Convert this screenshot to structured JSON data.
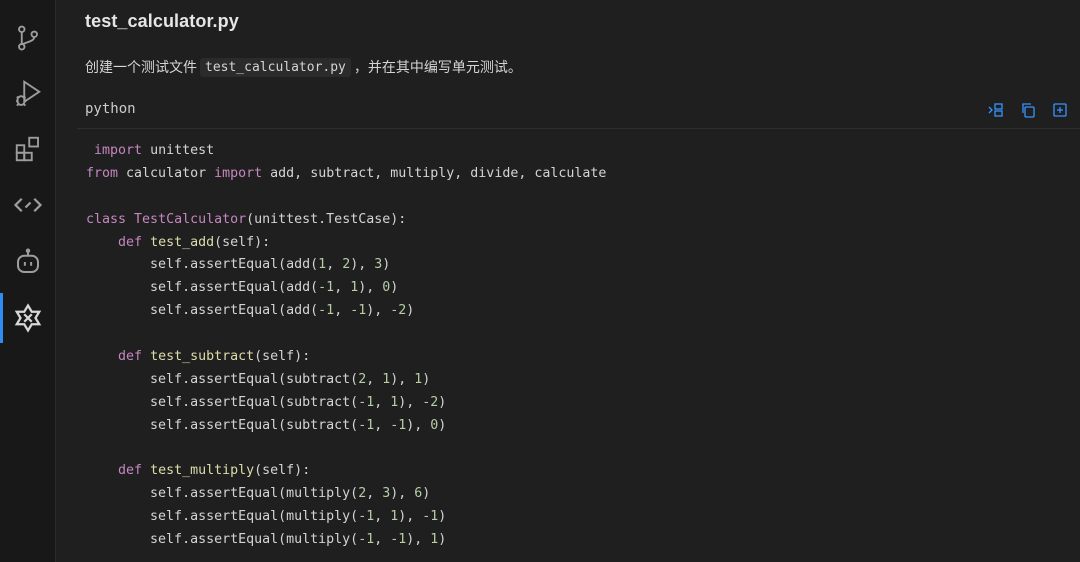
{
  "activity_bar": {
    "items": [
      {
        "name": "source-control-icon"
      },
      {
        "name": "run-debug-icon"
      },
      {
        "name": "extensions-icon"
      },
      {
        "name": "remote-explorer-icon"
      },
      {
        "name": "copilot-bot-icon"
      },
      {
        "name": "ai-assistant-icon",
        "active": true
      }
    ],
    "accent_color": "#2f8cf0"
  },
  "header": {
    "file_title": "test_calculator.py"
  },
  "description": {
    "prefix": "创建一个测试文件",
    "inline_code": "test_calculator.py",
    "suffix": "，并在其中编写单元测试。"
  },
  "code_block": {
    "language": "python",
    "actions": [
      "insert-at-cursor-icon",
      "copy-icon",
      "new-file-icon"
    ],
    "lines": [
      [
        {
          "t": " ",
          "k": "plain"
        },
        {
          "t": "import",
          "k": "kw"
        },
        {
          "t": " unittest",
          "k": "plain"
        }
      ],
      [
        {
          "t": "from",
          "k": "kw"
        },
        {
          "t": " calculator ",
          "k": "plain"
        },
        {
          "t": "import",
          "k": "kw"
        },
        {
          "t": " add, subtract, multiply, divide, calculate",
          "k": "plain"
        }
      ],
      [],
      [
        {
          "t": "class",
          "k": "kw"
        },
        {
          "t": " ",
          "k": "plain"
        },
        {
          "t": "TestCalculator",
          "k": "cls"
        },
        {
          "t": "(unittest.TestCase):",
          "k": "plain"
        }
      ],
      [
        {
          "t": "    ",
          "k": "plain"
        },
        {
          "t": "def",
          "k": "kw"
        },
        {
          "t": " ",
          "k": "plain"
        },
        {
          "t": "test_add",
          "k": "fn"
        },
        {
          "t": "(self):",
          "k": "plain"
        }
      ],
      [
        {
          "t": "        self.assertEqual(add(",
          "k": "plain"
        },
        {
          "t": "1",
          "k": "num"
        },
        {
          "t": ", ",
          "k": "plain"
        },
        {
          "t": "2",
          "k": "num"
        },
        {
          "t": "), ",
          "k": "plain"
        },
        {
          "t": "3",
          "k": "num"
        },
        {
          "t": ")",
          "k": "plain"
        }
      ],
      [
        {
          "t": "        self.assertEqual(add(",
          "k": "plain"
        },
        {
          "t": "-1",
          "k": "num"
        },
        {
          "t": ", ",
          "k": "plain"
        },
        {
          "t": "1",
          "k": "num"
        },
        {
          "t": "), ",
          "k": "plain"
        },
        {
          "t": "0",
          "k": "num"
        },
        {
          "t": ")",
          "k": "plain"
        }
      ],
      [
        {
          "t": "        self.assertEqual(add(",
          "k": "plain"
        },
        {
          "t": "-1",
          "k": "num"
        },
        {
          "t": ", ",
          "k": "plain"
        },
        {
          "t": "-1",
          "k": "num"
        },
        {
          "t": "), ",
          "k": "plain"
        },
        {
          "t": "-2",
          "k": "num"
        },
        {
          "t": ")",
          "k": "plain"
        }
      ],
      [],
      [
        {
          "t": "    ",
          "k": "plain"
        },
        {
          "t": "def",
          "k": "kw"
        },
        {
          "t": " ",
          "k": "plain"
        },
        {
          "t": "test_subtract",
          "k": "fn"
        },
        {
          "t": "(self):",
          "k": "plain"
        }
      ],
      [
        {
          "t": "        self.assertEqual(subtract(",
          "k": "plain"
        },
        {
          "t": "2",
          "k": "num"
        },
        {
          "t": ", ",
          "k": "plain"
        },
        {
          "t": "1",
          "k": "num"
        },
        {
          "t": "), ",
          "k": "plain"
        },
        {
          "t": "1",
          "k": "num"
        },
        {
          "t": ")",
          "k": "plain"
        }
      ],
      [
        {
          "t": "        self.assertEqual(subtract(",
          "k": "plain"
        },
        {
          "t": "-1",
          "k": "num"
        },
        {
          "t": ", ",
          "k": "plain"
        },
        {
          "t": "1",
          "k": "num"
        },
        {
          "t": "), ",
          "k": "plain"
        },
        {
          "t": "-2",
          "k": "num"
        },
        {
          "t": ")",
          "k": "plain"
        }
      ],
      [
        {
          "t": "        self.assertEqual(subtract(",
          "k": "plain"
        },
        {
          "t": "-1",
          "k": "num"
        },
        {
          "t": ", ",
          "k": "plain"
        },
        {
          "t": "-1",
          "k": "num"
        },
        {
          "t": "), ",
          "k": "plain"
        },
        {
          "t": "0",
          "k": "num"
        },
        {
          "t": ")",
          "k": "plain"
        }
      ],
      [],
      [
        {
          "t": "    ",
          "k": "plain"
        },
        {
          "t": "def",
          "k": "kw"
        },
        {
          "t": " ",
          "k": "plain"
        },
        {
          "t": "test_multiply",
          "k": "fn"
        },
        {
          "t": "(self):",
          "k": "plain"
        }
      ],
      [
        {
          "t": "        self.assertEqual(multiply(",
          "k": "plain"
        },
        {
          "t": "2",
          "k": "num"
        },
        {
          "t": ", ",
          "k": "plain"
        },
        {
          "t": "3",
          "k": "num"
        },
        {
          "t": "), ",
          "k": "plain"
        },
        {
          "t": "6",
          "k": "num"
        },
        {
          "t": ")",
          "k": "plain"
        }
      ],
      [
        {
          "t": "        self.assertEqual(multiply(",
          "k": "plain"
        },
        {
          "t": "-1",
          "k": "num"
        },
        {
          "t": ", ",
          "k": "plain"
        },
        {
          "t": "1",
          "k": "num"
        },
        {
          "t": "), ",
          "k": "plain"
        },
        {
          "t": "-1",
          "k": "num"
        },
        {
          "t": ")",
          "k": "plain"
        }
      ],
      [
        {
          "t": "        self.assertEqual(multiply(",
          "k": "plain"
        },
        {
          "t": "-1",
          "k": "num"
        },
        {
          "t": ", ",
          "k": "plain"
        },
        {
          "t": "-1",
          "k": "num"
        },
        {
          "t": "), ",
          "k": "plain"
        },
        {
          "t": "1",
          "k": "num"
        },
        {
          "t": ")",
          "k": "plain"
        }
      ]
    ]
  }
}
